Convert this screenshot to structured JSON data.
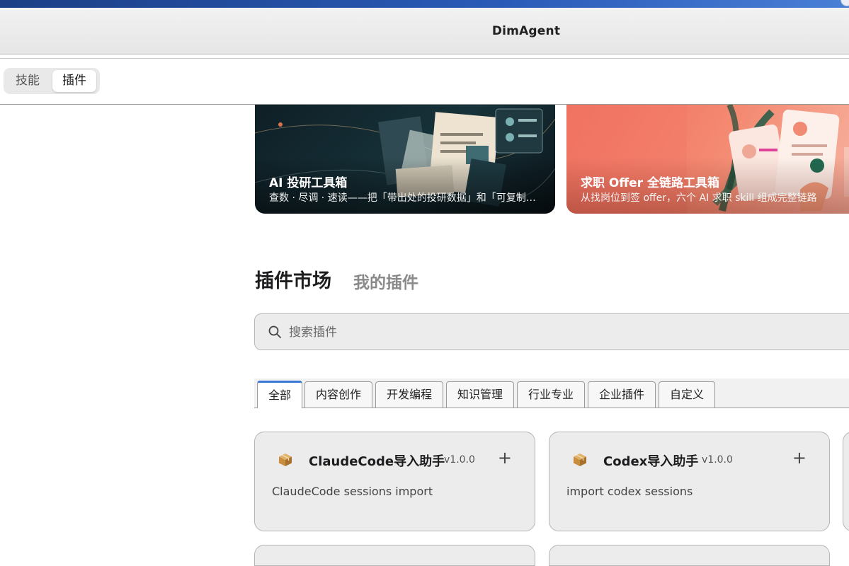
{
  "window": {
    "title": "DimAgent"
  },
  "segmented": {
    "items": [
      "技能",
      "插件"
    ],
    "active_index": 1
  },
  "banners": [
    {
      "title": "AI 投研工具箱",
      "subtitle": "查数 · 尽调 · 速读——把「带出处的投研数据」和「可复制…"
    },
    {
      "title": "求职 Offer 全链路工具箱",
      "subtitle": "从找岗位到签 offer，六个 AI 求职 skill 组成完整链路"
    }
  ],
  "market": {
    "title": "插件市场",
    "my_plugins": "我的插件"
  },
  "search": {
    "placeholder": "搜索插件",
    "value": ""
  },
  "categories": [
    "全部",
    "内容创作",
    "开发编程",
    "知识管理",
    "行业专业",
    "企业插件",
    "自定义"
  ],
  "active_category": 0,
  "plugins": [
    {
      "name": "ClaudeCode导入助手",
      "version": "v1.0.0",
      "description": "ClaudeCode sessions import",
      "add": "+"
    },
    {
      "name": "Codex导入助手",
      "version": "v1.0.0",
      "description": "import codex sessions",
      "add": "+"
    }
  ],
  "colors": {
    "accent": "#3b78d6",
    "card_bg": "#ececec"
  }
}
